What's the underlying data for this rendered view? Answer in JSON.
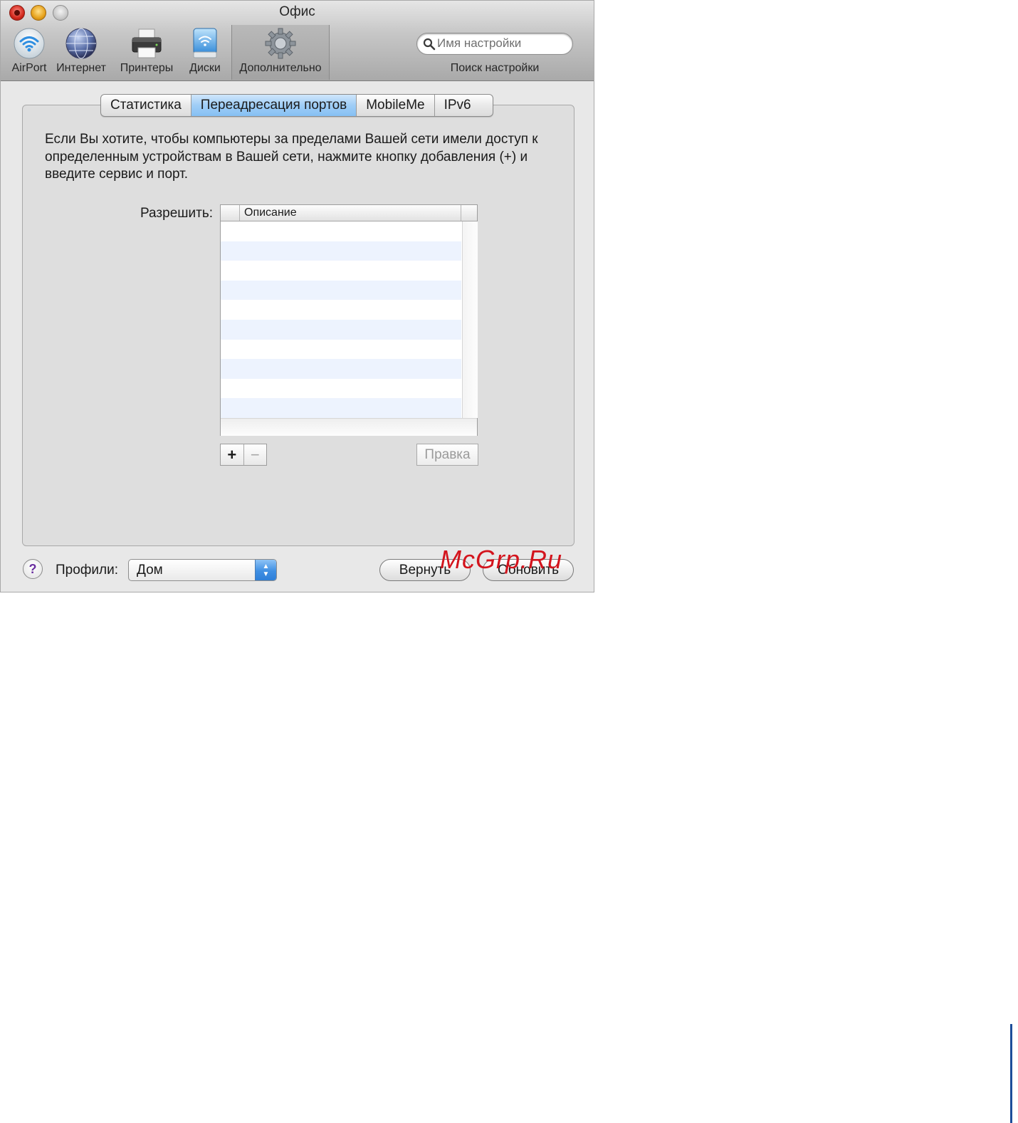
{
  "window": {
    "title": "Офис"
  },
  "toolbar": {
    "items": [
      {
        "label": "AirPort",
        "icon": "airport-icon"
      },
      {
        "label": "Интернет",
        "icon": "globe-icon"
      },
      {
        "label": "Принтеры",
        "icon": "printer-icon"
      },
      {
        "label": "Диски",
        "icon": "disk-icon"
      },
      {
        "label": "Дополнительно",
        "icon": "gear-icon",
        "selected": true
      }
    ],
    "search": {
      "placeholder": "Имя настройки",
      "label": "Поиск настройки"
    }
  },
  "tabs": [
    {
      "label": "Статистика"
    },
    {
      "label": "Переадресация портов",
      "active": true
    },
    {
      "label": "MobileMe"
    },
    {
      "label": "IPv6"
    }
  ],
  "main": {
    "description": "Если Вы хотите, чтобы компьютеры за пределами Вашей сети имели доступ к определенным устройствам в Вашей сети, нажмите кнопку добавления (+) и введите сервис и порт.",
    "allow_label": "Разрешить:",
    "table": {
      "column_description": "Описание"
    },
    "add_label": "+",
    "remove_label": "−",
    "edit_label": "Правка"
  },
  "footer": {
    "help_label": "?",
    "profiles_label": "Профили:",
    "profile_value": "Дом",
    "revert_label": "Вернуть",
    "update_label": "Обновить"
  },
  "watermark": "McGrp.Ru",
  "colors": {
    "active_tab": "#9fcdf6",
    "watermark": "#d3141d",
    "row_alt": "#edf3fe"
  }
}
